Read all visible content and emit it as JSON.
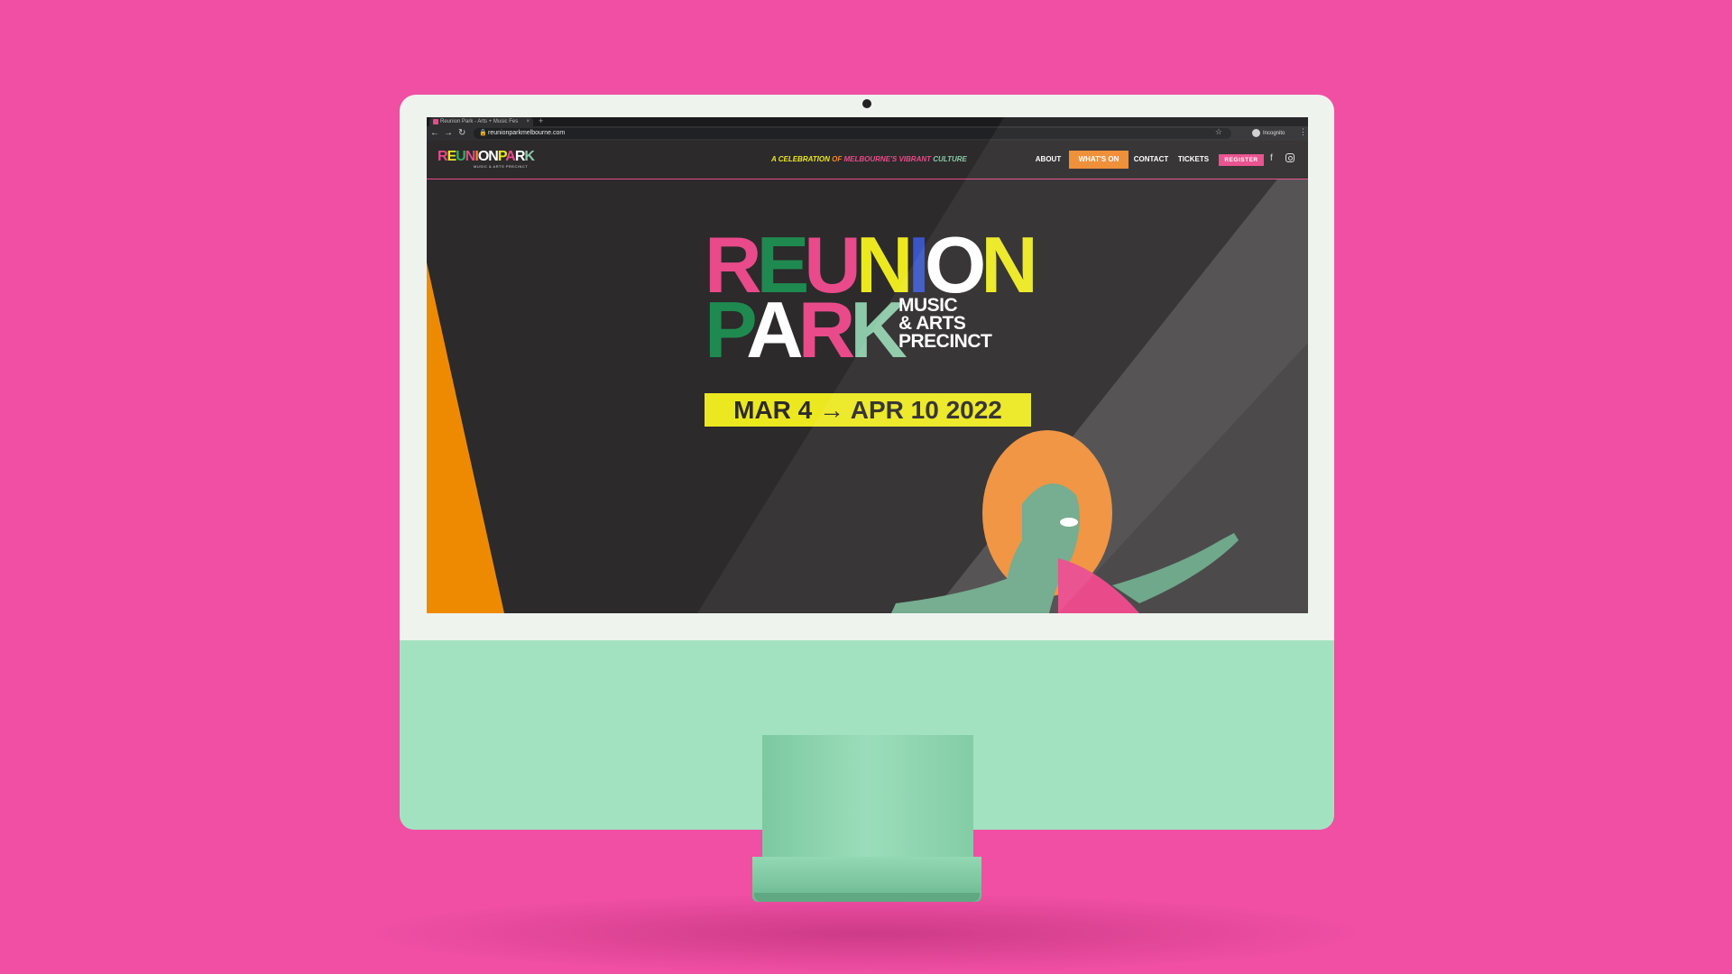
{
  "browser": {
    "tab_title": "Reunion Park - Arts + Music Fes",
    "tab_close": "×",
    "new_tab": "+",
    "url": "reunionparkmelbourne.com",
    "profile_label": "Incognito",
    "icons": {
      "back": "arrow-left-icon",
      "forward": "arrow-right-icon",
      "reload": "reload-icon",
      "lock": "lock-icon",
      "bookmark": "star-icon",
      "menu": "kebab-icon"
    }
  },
  "site": {
    "logo": {
      "text": "REUNIONPARK",
      "subtitle": "MUSIC & ARTS PRECINCT"
    },
    "tagline": {
      "part1": "A ",
      "part2": "CELEBRATION ",
      "part3": "OF ",
      "part4": "MELBOURNE'S ",
      "part5": "VIBRANT ",
      "part6": "CULTURE"
    },
    "nav": {
      "about": "ABOUT",
      "whats_on": "WHAT'S ON",
      "contact": "CONTACT",
      "tickets": "TICKETS",
      "register": "REGISTER"
    },
    "social": {
      "facebook": "f",
      "facebook_icon": "facebook-icon",
      "instagram_icon": "instagram-icon"
    },
    "hero": {
      "title_line1": "REUNION",
      "title_line2": "PARK",
      "subtitle_line1": "MUSIC",
      "subtitle_line2": "& ARTS",
      "subtitle_line3": "PRECINCT",
      "dates": "MAR 4 → APR 10 2022"
    }
  },
  "colors": {
    "background": "#f04fa4",
    "site_bg": "#2c2a2b",
    "accent_pink": "#e94a8a",
    "accent_orange": "#ee8a2e",
    "accent_yellow": "#ece81f",
    "accent_green": "#1f8a50",
    "imac_green": "#a3e2c0"
  }
}
